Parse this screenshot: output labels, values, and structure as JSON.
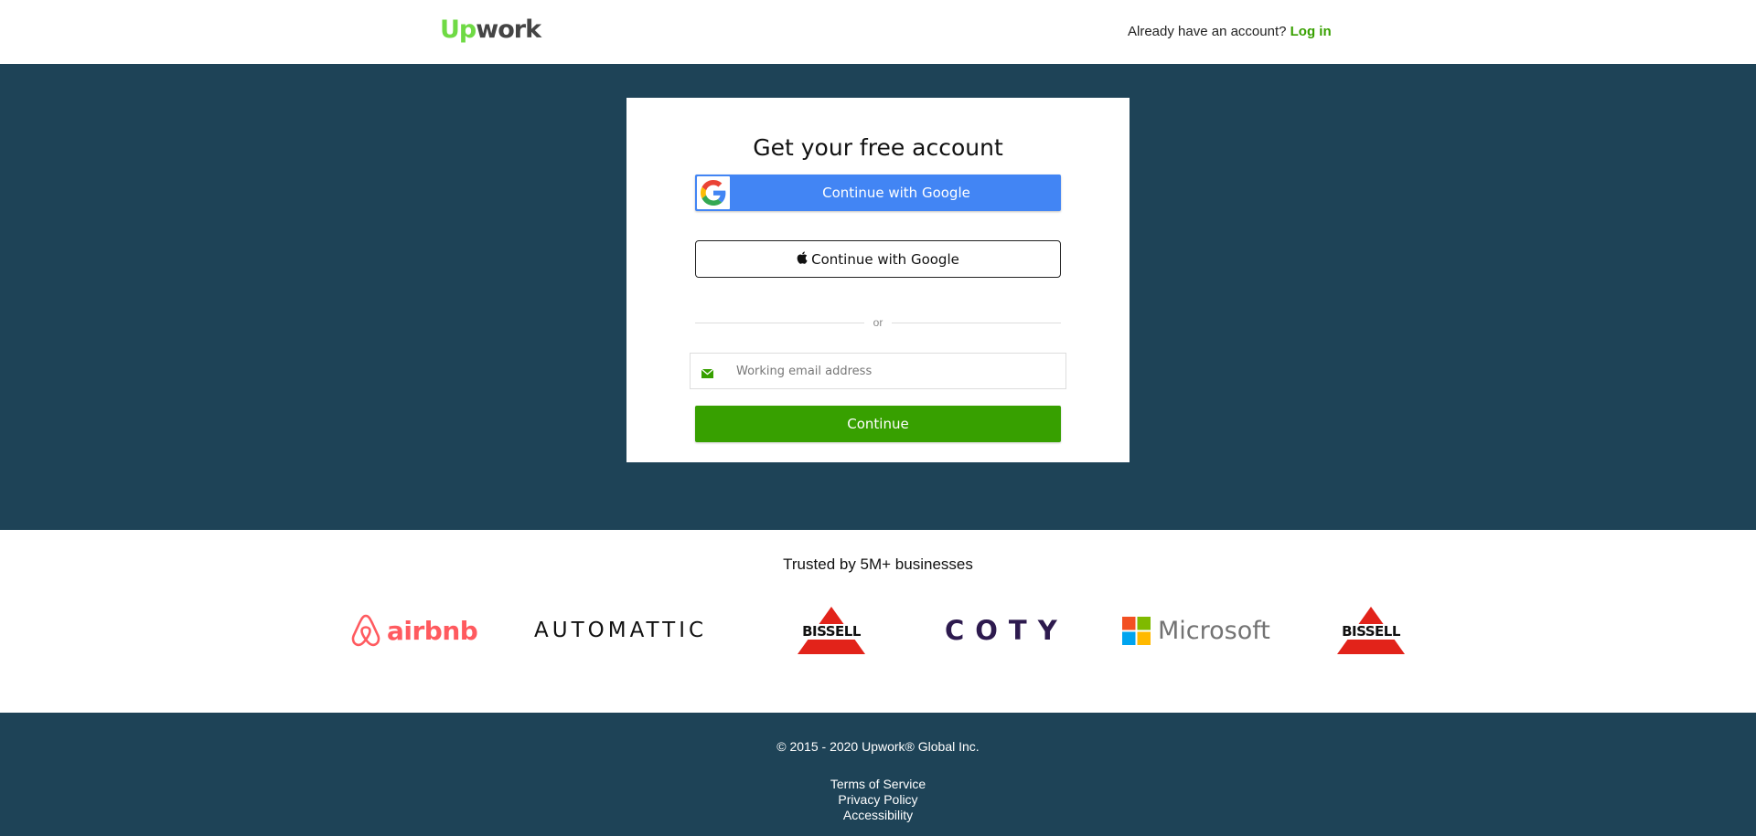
{
  "header": {
    "logo_up": "Up",
    "logo_work": "work",
    "login_prompt": "Already have an account?",
    "login_link": "Log in"
  },
  "signup": {
    "title": "Get your free account",
    "google_button": "Continue with Google",
    "apple_button": "Continue with Google",
    "divider_text": "or",
    "email_placeholder": "Working email address",
    "email_value": "",
    "continue_button": "Continue"
  },
  "trusted": {
    "title": "Trusted by 5M+ businesses",
    "logos": {
      "airbnb": "airbnb",
      "automattic": "AUTOMATTIC",
      "bissell": "BISSELL",
      "coty": "COTY",
      "microsoft": "Microsoft"
    }
  },
  "footer": {
    "copyright": "© 2015 - 2020 Upwork® Global Inc.",
    "links": {
      "terms": "Terms of Service",
      "privacy": "Privacy Policy",
      "accessibility": "Accessibility"
    }
  },
  "colors": {
    "brand_green": "#37a000",
    "logo_green": "#6fda44",
    "navy": "#1e4357",
    "google_blue": "#4285f4",
    "airbnb_red": "#ff5a5f",
    "coty_purple": "#2d1a4e"
  },
  "icons": {
    "google": "google-g-icon",
    "apple": "apple-icon",
    "email": "envelope-icon"
  }
}
